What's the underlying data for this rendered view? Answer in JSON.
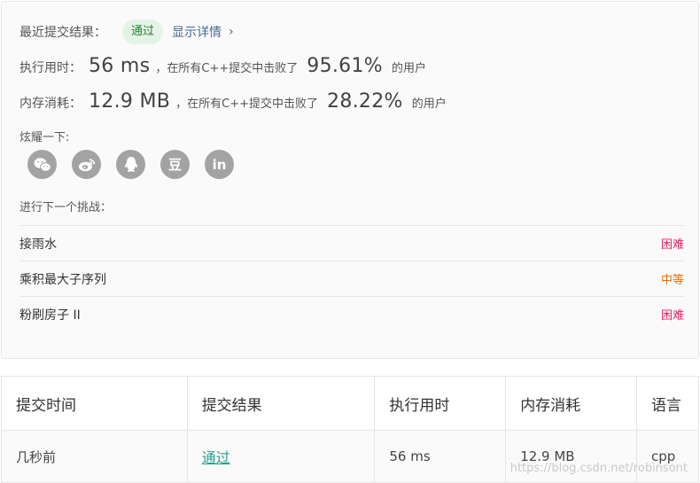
{
  "result": {
    "status_label": "最近提交结果：",
    "status_badge": "通过",
    "details_link": "显示详情",
    "runtime": {
      "label": "执行用时：",
      "value": "56 ms",
      "middle_text": "，在所有C++提交中击败了",
      "percent": "95.61%",
      "suffix": "的用户"
    },
    "memory": {
      "label": "内存消耗：",
      "value": "12.9 MB",
      "middle_text": "，在所有C++提交中击败了",
      "percent": "28.22%",
      "suffix": "的用户"
    },
    "share_label": "炫耀一下:",
    "share_icons": [
      "wechat-icon",
      "weibo-icon",
      "qq-icon",
      "douban-icon",
      "linkedin-icon"
    ],
    "next_label": "进行下一个挑战：",
    "problems": [
      {
        "name": "接雨水",
        "difficulty": "困难",
        "color": "#e91e63"
      },
      {
        "name": "乘积最大子序列",
        "difficulty": "中等",
        "color": "#ef6c00"
      },
      {
        "name": "粉刷房子 II",
        "difficulty": "困难",
        "color": "#e91e63"
      }
    ]
  },
  "submissions": {
    "headers": [
      "提交时间",
      "提交结果",
      "执行用时",
      "内存消耗",
      "语言"
    ],
    "rows": [
      {
        "time": "几秒前",
        "status": "通过",
        "runtime": "56 ms",
        "memory": "12.9 MB",
        "language": "cpp"
      }
    ]
  },
  "watermark": "https://blog.csdn.net/robinsont",
  "colors": {
    "accent": "#2a9d8f",
    "badge_bg": "#e3f4e6",
    "icon_gray": "#a3a3a3"
  }
}
